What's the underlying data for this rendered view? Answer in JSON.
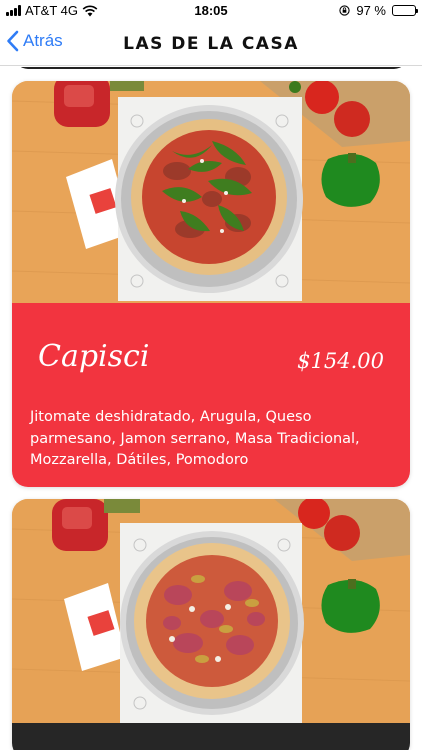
{
  "status_bar": {
    "carrier": "AT&T 4G",
    "time": "18:05",
    "battery_text": "97 %",
    "battery_level": 0.97,
    "icons": [
      "signal-icon",
      "wifi-icon",
      "rotation-lock-icon",
      "battery-icon"
    ]
  },
  "nav": {
    "back_label": "Atrás",
    "title": "LAS DE LA CASA"
  },
  "colors": {
    "accent_blue": "#2f7cf6",
    "card_red": "#f2343f",
    "card_dark": "#262626",
    "table_wood": "#e9a85a"
  },
  "pizzas": [
    {
      "name": "Capisci",
      "price": "$154.00",
      "ingredients": "Jitomate deshidratado, Arugula, Queso parmesano, Jamon serrano, Masa Tradicional, Mozzarella, Dátiles, Pomodoro"
    }
  ]
}
